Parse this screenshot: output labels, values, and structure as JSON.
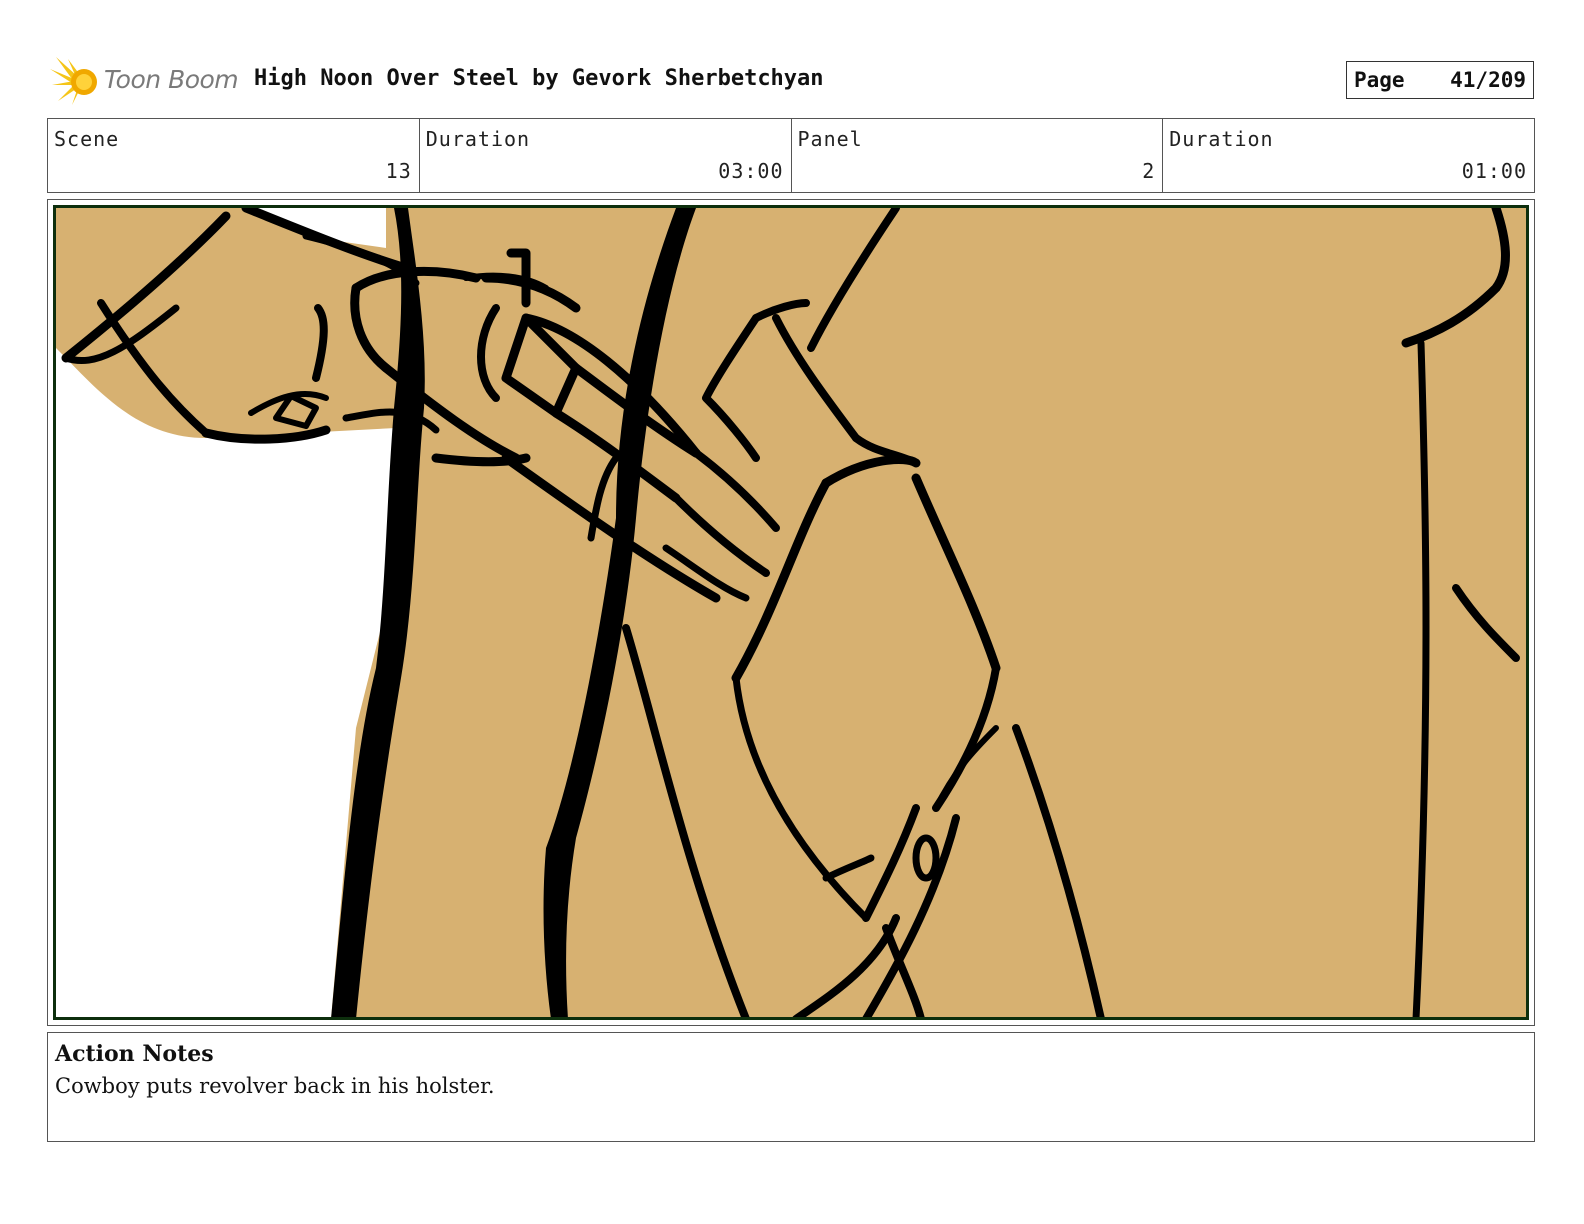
{
  "header": {
    "logo_text": "Toon Boom",
    "logo_icon": "starburst-logo-icon",
    "title": "High Noon Over Steel by Gevork Sherbetchyan",
    "page_label": "Page",
    "page_number": "41/209"
  },
  "info": {
    "scene_label": "Scene",
    "scene_value": "13",
    "scene_duration_label": "Duration",
    "scene_duration_value": "03:00",
    "panel_label": "Panel",
    "panel_value": "2",
    "panel_duration_label": "Duration",
    "panel_duration_value": "01:00"
  },
  "panel_image": {
    "description_icon": "storyboard-drawing",
    "colors": {
      "skin": "#d7b171",
      "ink": "#000000",
      "frame": "#0d2f0d"
    }
  },
  "notes": {
    "title": "Action Notes",
    "body": "Cowboy puts revolver back in his holster."
  }
}
